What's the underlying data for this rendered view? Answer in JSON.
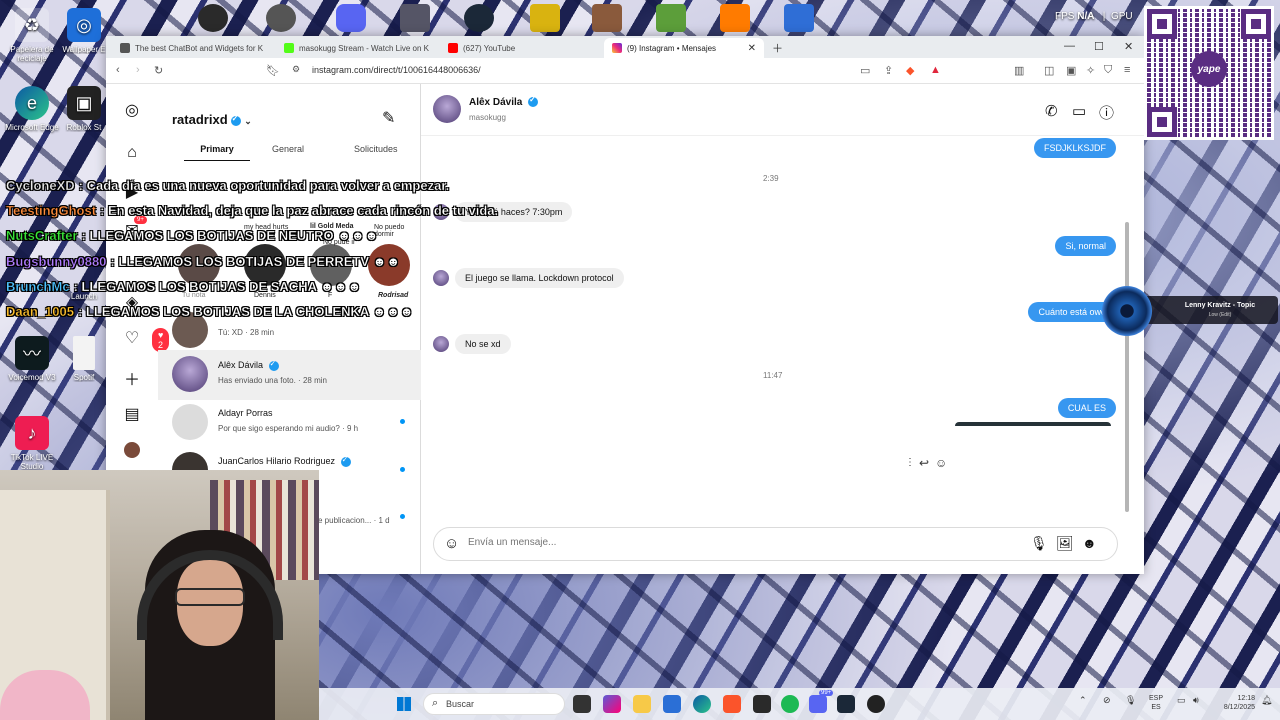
{
  "desktop": {
    "icons": [
      {
        "label": "Papelera de reciclaje",
        "icon": "recycle-bin-icon"
      },
      {
        "label": "Microsoft Edge",
        "icon": "edge-icon"
      },
      {
        "label": "Voicemod V3",
        "icon": "voicemod-icon"
      },
      {
        "label": "TikTok LIVE Studio",
        "icon": "tiktok-icon"
      }
    ],
    "partial_labels": [
      "Wallpaper E",
      "Roblox St",
      "Launch",
      "Spotif"
    ]
  },
  "top_strip": {
    "fps_label": "FPS",
    "fps_value": "N/A",
    "gpu_label": "GPU"
  },
  "browser": {
    "tabs": [
      {
        "title": "The best ChatBot and Widgets for K",
        "color": "#555555"
      },
      {
        "title": "masokugg Stream - Watch Live on K",
        "color": "#53fc18"
      },
      {
        "title": "(627) YouTube",
        "color": "#ff0000"
      },
      {
        "title": "(9) Instagram • Mensajes",
        "color": "#d6249f",
        "active": true
      }
    ],
    "url": "instagram.com/direct/t/100616448006636/"
  },
  "instagram": {
    "username": "ratadrixd",
    "tabs": [
      "Primary",
      "General",
      "Solicitudes"
    ],
    "notes_row": {
      "notes": [
        "my head hurts",
        "lil Gold Meda",
        "No pude ir",
        "No puedo dormir"
      ],
      "names": [
        "Tu nota",
        "Dennis",
        "F",
        "Rodrisad"
      ]
    },
    "notification_badge": "2",
    "notes_badge": "9+",
    "conversations": [
      {
        "name": "",
        "preview": "Tú: XD · 28 min",
        "unread": false
      },
      {
        "name": "Alêx Dávila",
        "preview": "Has enviado una foto. · 28 min",
        "unread": false,
        "verified": true,
        "selected": true
      },
      {
        "name": "Aldayr Porras",
        "preview": "Por que sigo esperando mi audio? · 9 h",
        "unread": true
      },
      {
        "name": "JuanCarlos Hilario Rodriguez",
        "preview": "",
        "unread": true,
        "verified": true
      },
      {
        "name": "",
        "preview": "e publicacion... · 1 d",
        "unread": true
      }
    ],
    "chat": {
      "name": "Alêx Dávila",
      "handle": "masokugg",
      "messages": [
        {
          "from": "me",
          "text": "FSDJKLKSJDF"
        },
        {
          "type": "time",
          "text": "2:39"
        },
        {
          "from": "them",
          "text": "Y tú qué haces? 7:30pm"
        },
        {
          "from": "me",
          "text": "Si, normal"
        },
        {
          "from": "them",
          "text": "El juego se llama. Lockdown protocol"
        },
        {
          "from": "me",
          "text": "Cuánto está owo"
        },
        {
          "from": "them",
          "text": "No se xd"
        },
        {
          "type": "time",
          "text": "11:47"
        },
        {
          "from": "me",
          "text": "CUAL ES"
        }
      ],
      "composer_placeholder": "Envía un mensaje..."
    }
  },
  "stream_chat_overlay": [
    {
      "user": "CycloneXD",
      "user_color": "#e8e8e8",
      "text": "Cada día es una nueva oportunidad para volver a empezar."
    },
    {
      "user": "TeestingGhost",
      "user_color": "#ff8c3b",
      "text": "En esta Navidad, deja que la paz abrace cada rincón de tu vida."
    },
    {
      "user": "NutsCrafter",
      "user_color": "#39e639",
      "text": "LLEGAMOS LOS BOTIJAS DE NEUTRO"
    },
    {
      "user": "Bugsbunny0880",
      "user_color": "#b07cff",
      "text": "LLEGAMOS LOS BOTIJAS DE PERRETV"
    },
    {
      "user": "BrunchMc",
      "user_color": "#4fc3ff",
      "text": "LLEGAMOS LOS BOTIJAS DE SACHA"
    },
    {
      "user": "Daan_1005",
      "user_color": "#ffc02e",
      "text": "LLEGAMOS LOS BOTIJAS DE LA CHOLENKA"
    }
  ],
  "qr_widget": {
    "brand": "yape",
    "color": "#5a2d82"
  },
  "now_playing": {
    "title": "Lenny Kravitz - Topic",
    "subtitle": "Low (Edit)"
  },
  "taskbar": {
    "search_label": "Buscar",
    "badge": "99+",
    "language": [
      "ESP",
      "ES"
    ],
    "time": "12:18",
    "date": "8/12/2025"
  }
}
